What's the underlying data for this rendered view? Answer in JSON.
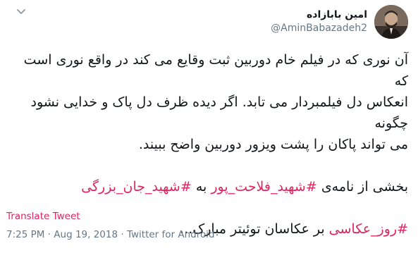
{
  "author": {
    "display_name": "امین بابازاده",
    "handle": "@AminBabazadeh2"
  },
  "tweet": {
    "lines": [
      "آن نوری که در فیلم خام دوربین ثبت وقایع می کند در واقع نوری است که",
      "انعکاس دل فیلمبردار می تابد. اگر دیده ظرف دل پاک و خدایی نشود چگونه",
      "می تواند پاکان را پشت ویزور دوربین واضح ببیند."
    ],
    "line4_prefix": "بخشی از نامه‌ی",
    "hashtag_1": "#شهید_فلاحت_پور",
    "line4_middle": "به",
    "hashtag_2": "#شهید_جان_بزرگی",
    "hashtag_3": "#روز_عکاسی",
    "line5_suffix": "بر عکاسان توئیتر مبارک..."
  },
  "translate_label": "Translate Tweet",
  "meta": {
    "time": "7:25 PM",
    "sep": "·",
    "date": "Aug 19, 2018",
    "source": "Twitter for Android"
  },
  "colors": {
    "accent": "#e0245e",
    "text": "#14171a",
    "secondary": "#657786"
  },
  "icons": {
    "menu": "chevron-down-icon"
  }
}
